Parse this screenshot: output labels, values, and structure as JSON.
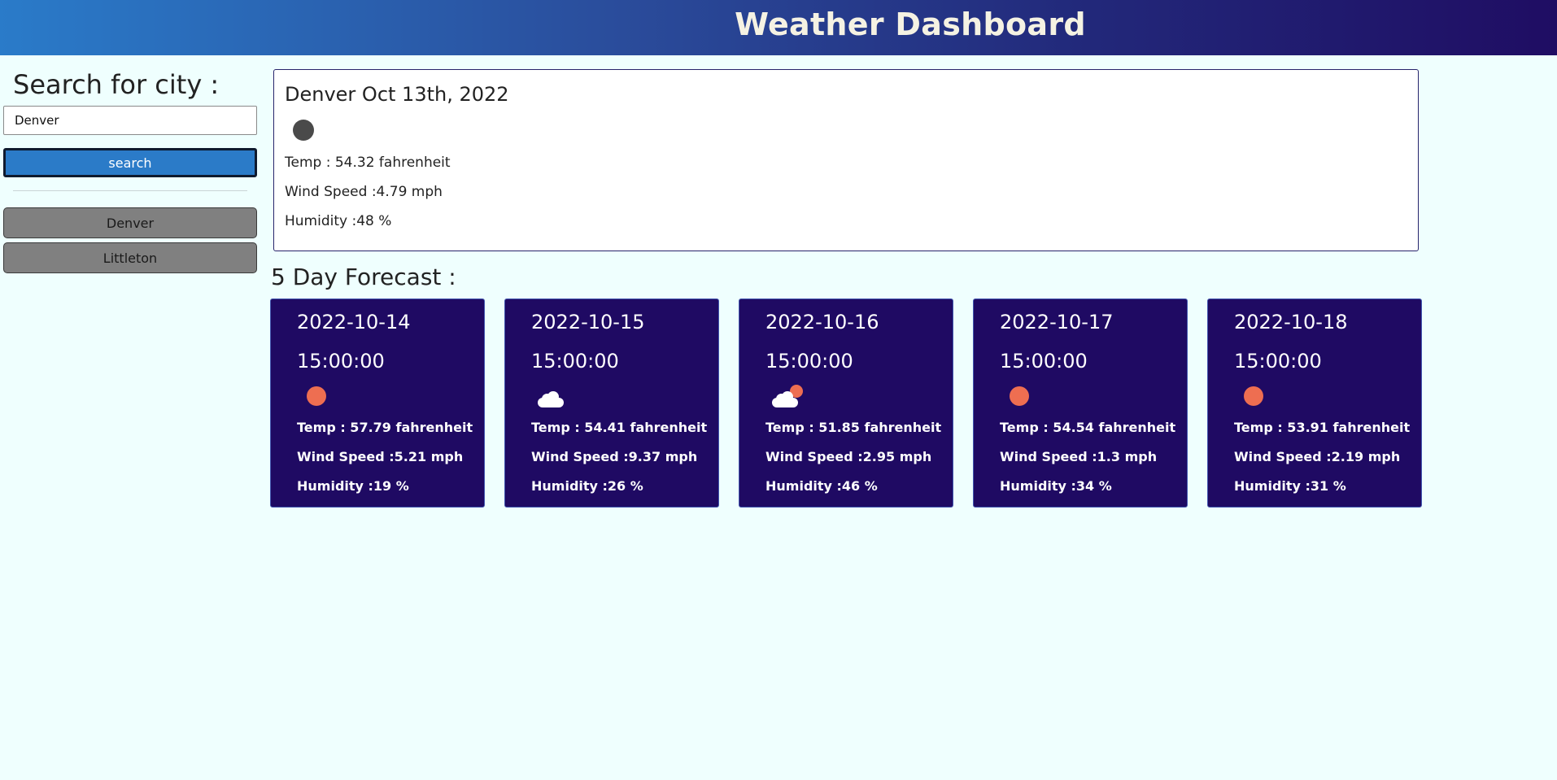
{
  "header": {
    "title": "Weather Dashboard"
  },
  "sidebar": {
    "search_title": "Search for city :",
    "input_value": "Denver",
    "search_button": "search",
    "history": [
      "Denver",
      "Littleton"
    ]
  },
  "current": {
    "heading": "Denver Oct 13th, 2022",
    "icon": "moon-icon",
    "temp": "Temp : 54.32 fahrenheit",
    "wind": "Wind Speed :4.79 mph",
    "humidity": "Humidity :48 %"
  },
  "forecast": {
    "title": "5 Day Forecast :",
    "days": [
      {
        "date": "2022-10-14",
        "time": "15:00:00",
        "icon": "sun-icon",
        "temp": "Temp : 57.79 fahrenheit",
        "wind": "Wind Speed :5.21 mph",
        "humidity": "Humidity :19 %"
      },
      {
        "date": "2022-10-15",
        "time": "15:00:00",
        "icon": "cloud-icon",
        "temp": "Temp : 54.41 fahrenheit",
        "wind": "Wind Speed :9.37 mph",
        "humidity": "Humidity :26 %"
      },
      {
        "date": "2022-10-16",
        "time": "15:00:00",
        "icon": "partly-cloudy-icon",
        "temp": "Temp : 51.85 fahrenheit",
        "wind": "Wind Speed :2.95 mph",
        "humidity": "Humidity :46 %"
      },
      {
        "date": "2022-10-17",
        "time": "15:00:00",
        "icon": "sun-icon",
        "temp": "Temp : 54.54 fahrenheit",
        "wind": "Wind Speed :1.3 mph",
        "humidity": "Humidity :34 %"
      },
      {
        "date": "2022-10-18",
        "time": "15:00:00",
        "icon": "sun-icon",
        "temp": "Temp : 53.91 fahrenheit",
        "wind": "Wind Speed :2.19 mph",
        "humidity": "Humidity :31 %"
      }
    ]
  },
  "colors": {
    "background": "#effffe",
    "header_start": "#2a7bc9",
    "header_end": "#1f0d63",
    "search_button": "#2b7bc8",
    "history_button": "#808080",
    "forecast_card": "#1f0a63",
    "sun": "#ee6e51",
    "moon": "#4a4a4a"
  }
}
